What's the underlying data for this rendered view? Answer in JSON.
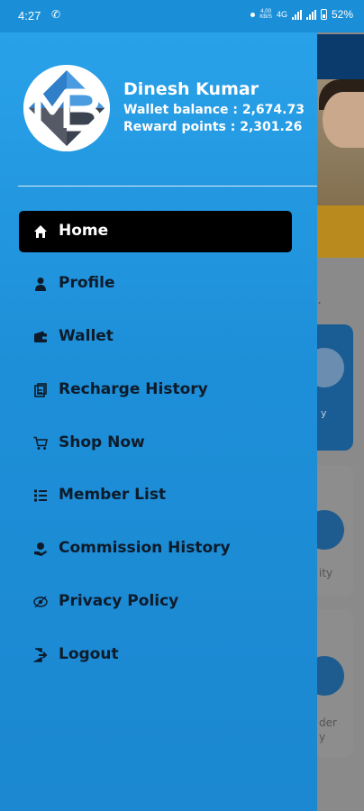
{
  "status_bar": {
    "time": "4:27",
    "network_speed": "4.00\nKB/S",
    "network_type": "4G",
    "battery": "52%"
  },
  "profile": {
    "name": "Dinesh Kumar",
    "wallet_balance": "Wallet balance : 2,674.73",
    "reward_points": "Reward points : 2,301.26"
  },
  "menu": [
    {
      "label": "Home",
      "icon": "home-icon",
      "active": true
    },
    {
      "label": "Profile",
      "icon": "person-icon",
      "active": false
    },
    {
      "label": "Wallet",
      "icon": "wallet-icon",
      "active": false
    },
    {
      "label": "Recharge History",
      "icon": "history-doc-icon",
      "active": false
    },
    {
      "label": "Shop Now",
      "icon": "cart-icon",
      "active": false
    },
    {
      "label": "Member List",
      "icon": "list-icon",
      "active": false
    },
    {
      "label": "Commission History",
      "icon": "commission-icon",
      "active": false
    },
    {
      "label": "Privacy Policy",
      "icon": "privacy-icon",
      "active": false
    },
    {
      "label": "Logout",
      "icon": "logout-icon",
      "active": false
    }
  ],
  "background_app": {
    "card_texts": [
      "ity",
      "der\ny"
    ]
  },
  "colors": {
    "drawer": "#1d8fd8",
    "active_item": "#000000",
    "text": "#0d1b2a"
  }
}
